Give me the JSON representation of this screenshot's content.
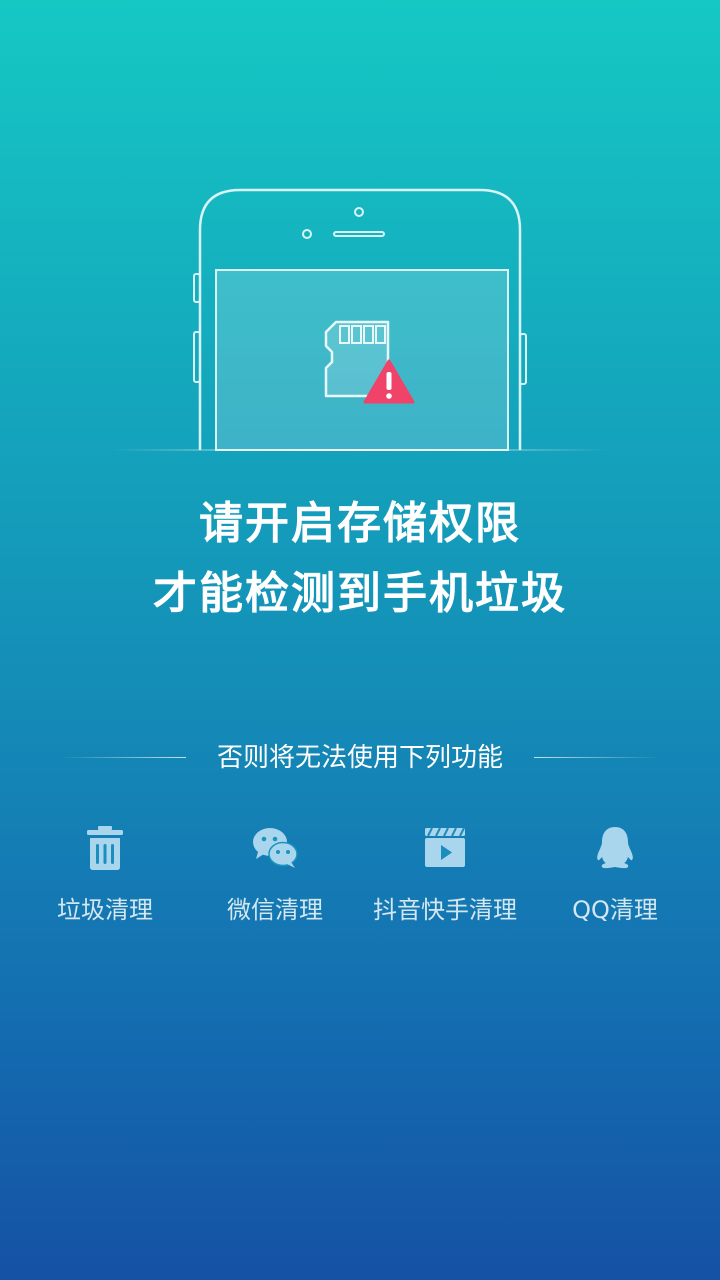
{
  "headline": {
    "line1": "请开启存储权限",
    "line2": "才能检测到手机垃圾"
  },
  "divider_text": "否则将无法使用下列功能",
  "features": [
    {
      "label": "垃圾清理",
      "icon": "trash-icon"
    },
    {
      "label": "微信清理",
      "icon": "wechat-icon"
    },
    {
      "label": "抖音快手清理",
      "icon": "video-icon"
    },
    {
      "label": "QQ清理",
      "icon": "qq-penguin-icon"
    }
  ],
  "colors": {
    "gradient_top": "#15c8c4",
    "gradient_bottom": "#1551a5",
    "warning_red": "#f0436a",
    "icon_fill": "#a9d6ec"
  }
}
